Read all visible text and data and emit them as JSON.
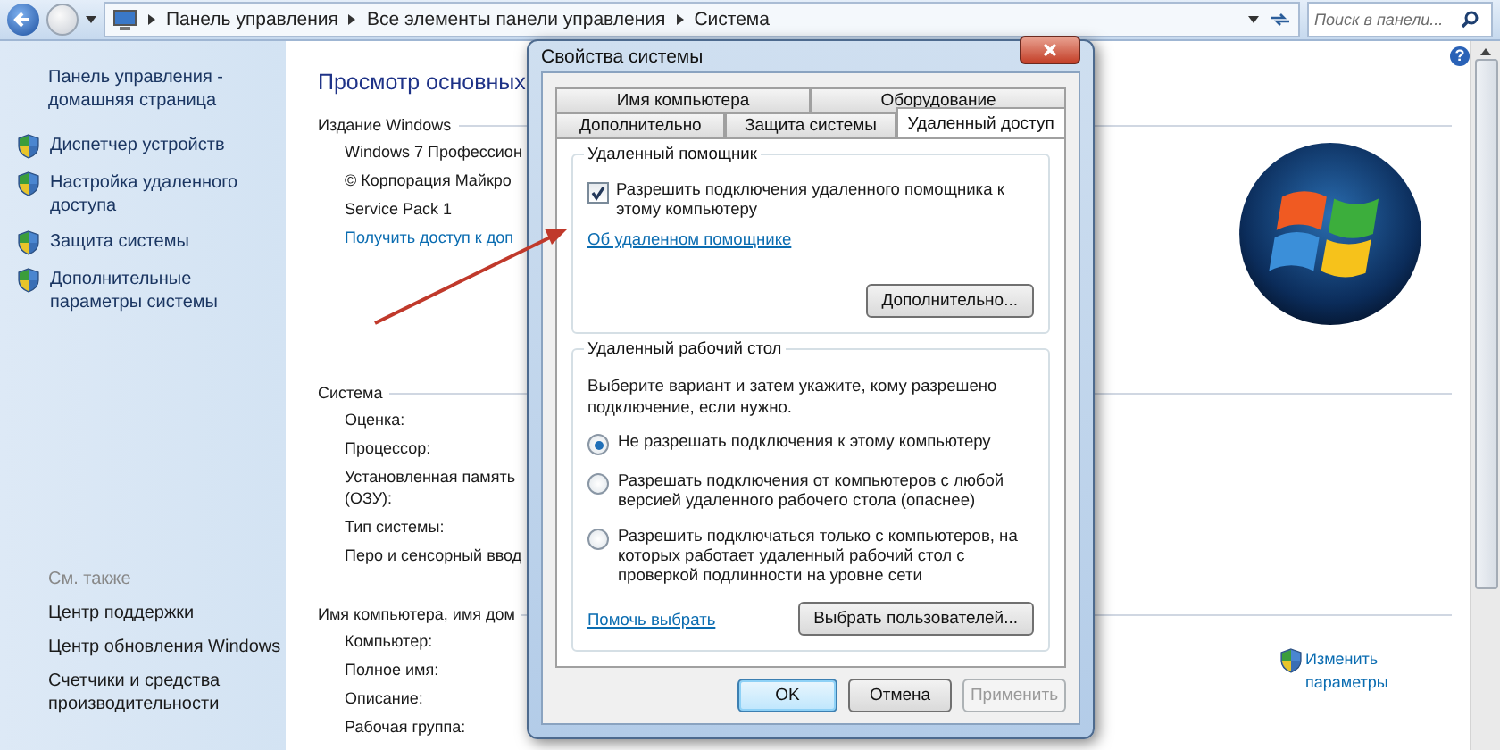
{
  "address_bar": {
    "breadcrumbs": [
      "Панель управления",
      "Все элементы панели управления",
      "Система"
    ],
    "search": {
      "placeholder": "Поиск в панели..."
    }
  },
  "sidebar": {
    "home_link": "Панель управления - домашняя страница",
    "tasks": [
      "Диспетчер устройств",
      "Настройка удаленного доступа",
      "Защита системы",
      "Дополнительные параметры системы"
    ],
    "see_also_title": "См. также",
    "see_also": [
      "Центр поддержки",
      "Центр обновления Windows",
      "Счетчики и средства производительности"
    ]
  },
  "help_button": {
    "glyph": "?"
  },
  "main": {
    "title": "Просмотр основных",
    "sections": [
      {
        "heading": "Издание Windows",
        "rows": [
          {
            "kind": "text",
            "text": "Windows 7 Профессион"
          },
          {
            "kind": "text",
            "text": "© Корпорация Майкро"
          },
          {
            "kind": "text",
            "text": "Service Pack 1"
          },
          {
            "kind": "link",
            "text": "Получить доступ к доп"
          }
        ]
      },
      {
        "heading": "Система",
        "rows": [
          {
            "kind": "text",
            "text": "Оценка:"
          },
          {
            "kind": "text",
            "text": "Процессор:"
          },
          {
            "kind": "text",
            "text": "Установленная память (ОЗУ):"
          },
          {
            "kind": "text",
            "text": "Тип системы:"
          },
          {
            "kind": "text",
            "text": "Перо и сенсорный ввод"
          }
        ]
      },
      {
        "heading": "Имя компьютера, имя дом",
        "rows": [
          {
            "kind": "text",
            "text": "Компьютер:"
          },
          {
            "kind": "text",
            "text": "Полное имя:"
          },
          {
            "kind": "text",
            "text": "Описание:"
          },
          {
            "kind": "text",
            "text": "Рабочая группа:"
          }
        ]
      }
    ],
    "change_settings_link": "Изменить параметры"
  },
  "dialog": {
    "title": "Свойства системы",
    "tab_rows": [
      [
        {
          "label": "Имя компьютера",
          "selected": false
        },
        {
          "label": "Оборудование",
          "selected": false
        }
      ],
      [
        {
          "label": "Дополнительно",
          "selected": false
        },
        {
          "label": "Защита системы",
          "selected": false
        },
        {
          "label": "Удаленный доступ",
          "selected": true
        }
      ]
    ],
    "remote_assistance": {
      "title": "Удаленный помощник",
      "checkbox": {
        "label": "Разрешить подключения удаленного помощника к этому компьютеру",
        "checked": true
      },
      "link": "Об удаленном помощнике",
      "button": "Дополнительно..."
    },
    "remote_desktop": {
      "title": "Удаленный рабочий стол",
      "description": "Выберите вариант и затем укажите, кому разрешено подключение, если нужно.",
      "options": [
        {
          "label": "Не разрешать подключения к этому компьютеру",
          "selected": true
        },
        {
          "label": "Разрешать подключения от компьютеров с любой версией удаленного рабочего стола (опаснее)",
          "selected": false
        },
        {
          "label": "Разрешить подключаться только с компьютеров, на которых работает удаленный рабочий стол с проверкой подлинности на уровне сети",
          "selected": false
        }
      ],
      "link": "Помочь выбрать",
      "button": "Выбрать пользователей..."
    },
    "buttons": [
      {
        "label": "OK",
        "kind": "default",
        "disabled": false
      },
      {
        "label": "Отмена",
        "kind": "normal",
        "disabled": false
      },
      {
        "label": "Применить",
        "kind": "normal",
        "disabled": true
      }
    ]
  }
}
